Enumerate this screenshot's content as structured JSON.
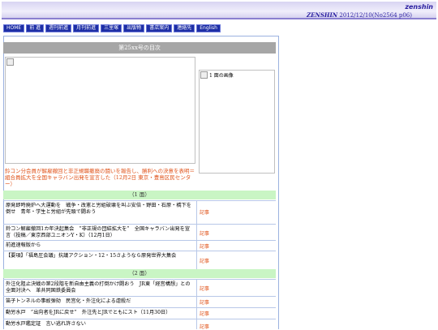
{
  "header": {
    "logo": "zenshin",
    "issue_prefix": "ZENSHIN",
    "issue_text": " 2012/12/10(No2564 p06)"
  },
  "nav": [
    "HOME",
    "前 進",
    "週刊前進",
    "月刊前進",
    "三里塚",
    "出版物",
    "書店案内",
    "連絡先",
    "English"
  ],
  "toc": {
    "title": "第25xx号の目次",
    "page1_caption": "1 面の画像",
    "lead": "鈴コン分会員が解雇撤回と非正規職撤廃の闘いを報告し、勝利への決意を表明＝組合員拡大を全国キャラバン出発を宣言した（12月2日 東京・豊島区民センター）"
  },
  "sections": [
    {
      "label": "（1 面）"
    },
    {
      "label": "（2 面）"
    }
  ],
  "articles": [
    {
      "text": "原発即時廃炉へ大運動を　戦争・改憲と労組破壊を叫ぶ安倍・野田・石原・橋下を倒せ　青年・学生と労組が先頭で闘おう",
      "link": "記事"
    },
    {
      "text": "鈴コン解雇撤回1カ年決起集会　”非正規の団結拡大を”　全国キャラバン出発を宣言（投稿／東京西部ユニオンY・K）（12月1日）",
      "link": "記事"
    },
    {
      "text": "前進速報版から",
      "link": "記事"
    },
    {
      "text": "【要項】「福島圧会議」抗議アクション・12・15さようなら原発世界大集会",
      "link": "記事"
    },
    {
      "text": "外注化阻止決戦の第2段階を新自由主義の打倒かけ闘おう　JR東「経営構想」との全面対決へ　革共同国鉄委員会",
      "link": "記事"
    },
    {
      "text": "笛子トンネルの事故弾劾　民営化・外注化による虐殺だ",
      "link": "記事"
    },
    {
      "text": "動労水戸　”出向者をJRに戻せ”　外注先とJRでともにスト（11月30日）",
      "link": "記事"
    },
    {
      "text": "動労水戸鑑定証　言い逃れ許さない",
      "link": "記事"
    }
  ]
}
